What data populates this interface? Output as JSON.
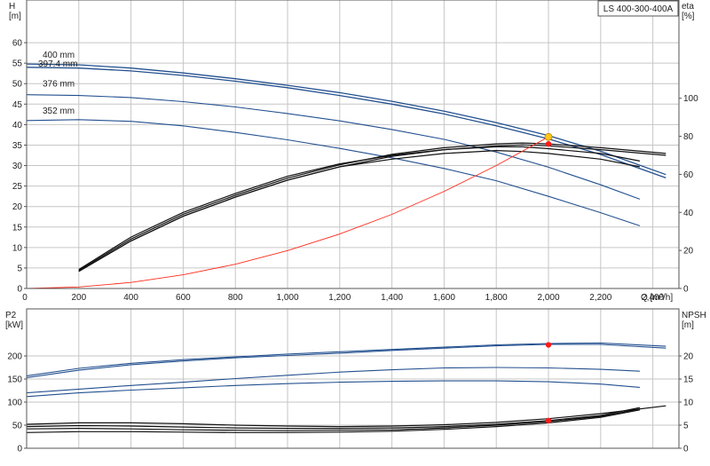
{
  "model_label": "LS 400-300-400A",
  "colors": {
    "head_curve": "#23508f",
    "eff_curve": "#111111",
    "system_curve": "#ff2b1c",
    "duty_point_head": "#ffc61a",
    "duty_point": "#ff1a1a"
  },
  "chart_data": [
    {
      "type": "line",
      "id": "head-efficiency",
      "xlabel": "Q [m³/h]",
      "x_ticks": [
        "0",
        "200",
        "400",
        "600",
        "800",
        "1,000",
        "1,200",
        "1,400",
        "1,600",
        "1,800",
        "2,000",
        "2,200",
        "2,400"
      ],
      "xlim": [
        0,
        2500
      ],
      "ylabel_left": "H [m]",
      "ylabel_left_lines": [
        "H",
        "[m]"
      ],
      "ylim_left": [
        0,
        65
      ],
      "yticks_left": [
        0,
        5,
        10,
        15,
        20,
        25,
        30,
        35,
        40,
        45,
        50,
        55,
        60
      ],
      "ylabel_right": "eta [%]",
      "ylabel_right_lines": [
        "eta",
        "[%]"
      ],
      "ylim_right": [
        0,
        140
      ],
      "yticks_right": [
        0,
        20,
        40,
        60,
        80,
        100
      ],
      "grid": true,
      "head_series": [
        {
          "name": "400 mm",
          "x": [
            0,
            200,
            400,
            600,
            800,
            1000,
            1200,
            1400,
            1600,
            1800,
            2000,
            2200,
            2450
          ],
          "y": [
            54.8,
            54.6,
            53.8,
            52.6,
            51.2,
            49.6,
            47.8,
            45.7,
            43.3,
            40.5,
            37.3,
            33.5,
            27.8
          ]
        },
        {
          "name": "397.4 mm",
          "x": [
            0,
            200,
            400,
            600,
            800,
            1000,
            1200,
            1400,
            1600,
            1800,
            2000,
            2200,
            2450
          ],
          "y": [
            54.0,
            53.8,
            53.1,
            52.0,
            50.6,
            49.0,
            47.1,
            45.0,
            42.6,
            39.7,
            36.5,
            32.7,
            27.0
          ]
        },
        {
          "name": "376 mm",
          "x": [
            0,
            200,
            400,
            600,
            800,
            1000,
            1200,
            1400,
            1600,
            1800,
            2000,
            2200,
            2350
          ],
          "y": [
            47.3,
            47.1,
            46.6,
            45.6,
            44.3,
            42.7,
            40.9,
            38.8,
            36.4,
            33.3,
            29.6,
            25.3,
            21.8
          ]
        },
        {
          "name": "352 mm",
          "x": [
            0,
            200,
            400,
            600,
            800,
            1000,
            1200,
            1400,
            1600,
            1800,
            2000,
            2200,
            2350
          ],
          "y": [
            41.0,
            41.2,
            40.8,
            39.7,
            38.1,
            36.3,
            34.2,
            31.9,
            29.3,
            26.3,
            22.5,
            18.5,
            15.3
          ]
        }
      ],
      "efficiency_series": [
        {
          "x": [
            200,
            400,
            600,
            800,
            1000,
            1200,
            1400,
            1600,
            1800,
            1900,
            2000,
            2200,
            2450
          ],
          "y": [
            9.5,
            26,
            39,
            49,
            58,
            65,
            70.5,
            74,
            76,
            76.5,
            76,
            74,
            71
          ]
        },
        {
          "x": [
            200,
            400,
            600,
            800,
            1000,
            1200,
            1400,
            1600,
            1800,
            1900,
            2000,
            2200,
            2450
          ],
          "y": [
            9,
            25,
            38,
            48,
            57,
            64,
            69.5,
            73,
            75,
            75.5,
            75,
            73,
            70
          ]
        },
        {
          "x": [
            200,
            400,
            600,
            800,
            1000,
            1200,
            1400,
            1600,
            1800,
            1900,
            2000,
            2200,
            2350
          ],
          "y": [
            10,
            27,
            40,
            50,
            59,
            65.5,
            70,
            73,
            74.5,
            74.5,
            73.5,
            71,
            67
          ]
        },
        {
          "x": [
            200,
            400,
            600,
            800,
            1000,
            1200,
            1400,
            1600,
            1800,
            1900,
            2000,
            2200,
            2350
          ],
          "y": [
            9,
            25,
            38,
            48,
            57,
            64,
            68,
            71,
            72.5,
            72,
            71,
            68,
            64
          ]
        }
      ],
      "system_curve": {
        "x": [
          0,
          200,
          400,
          600,
          800,
          1000,
          1200,
          1400,
          1600,
          1800,
          2000
        ],
        "y": [
          0,
          0.37,
          1.48,
          3.33,
          5.92,
          9.25,
          13.3,
          18.1,
          23.7,
          30.0,
          37.0
        ]
      },
      "duty_point_head": {
        "x": 2000,
        "y": 37.0
      },
      "duty_point_eta": {
        "x": 2000,
        "y": 76
      }
    },
    {
      "type": "line",
      "id": "power-npsh",
      "ylabel_left": "P2 [kW]",
      "ylabel_left_lines": [
        "P2",
        "[kW]"
      ],
      "ylim_left": [
        0,
        250
      ],
      "yticks_left": [
        0,
        50,
        100,
        150,
        200
      ],
      "ylabel_right": "NPSH [m]",
      "ylabel_right_lines": [
        "NPSH",
        "[m]"
      ],
      "ylim_right": [
        0,
        25
      ],
      "yticks_right": [
        0,
        5,
        10,
        15,
        20
      ],
      "xlim": [
        0,
        2500
      ],
      "grid": true,
      "power_series": [
        {
          "x": [
            0,
            200,
            400,
            600,
            800,
            1000,
            1200,
            1400,
            1600,
            1800,
            2000,
            2200,
            2450
          ],
          "y": [
            157,
            173,
            184,
            192,
            198,
            204,
            209,
            214,
            219,
            224,
            227,
            228,
            221
          ]
        },
        {
          "x": [
            0,
            200,
            400,
            600,
            800,
            1000,
            1200,
            1400,
            1600,
            1800,
            2000,
            2200,
            2450
          ],
          "y": [
            153,
            169,
            181,
            189,
            196,
            201,
            206,
            212,
            217,
            222,
            225,
            225,
            217
          ]
        },
        {
          "x": [
            0,
            200,
            400,
            600,
            800,
            1000,
            1200,
            1400,
            1600,
            1800,
            2000,
            2200,
            2350
          ],
          "y": [
            120,
            128,
            136,
            143,
            151,
            158,
            165,
            170,
            174,
            175,
            174,
            171,
            167
          ]
        },
        {
          "x": [
            0,
            200,
            400,
            600,
            800,
            1000,
            1200,
            1400,
            1600,
            1800,
            2000,
            2200,
            2350
          ],
          "y": [
            112,
            120,
            126,
            131,
            136,
            140,
            143,
            145,
            146,
            146,
            144,
            139,
            132
          ]
        }
      ],
      "npsh_series": [
        {
          "x": [
            0,
            200,
            400,
            600,
            800,
            1000,
            1200,
            1400,
            1600,
            1800,
            2000,
            2200,
            2450
          ],
          "y": [
            5.2,
            5.5,
            5.5,
            5.3,
            5.0,
            4.8,
            4.7,
            4.8,
            5.1,
            5.6,
            6.4,
            7.5,
            9.2
          ]
        },
        {
          "x": [
            0,
            200,
            400,
            600,
            800,
            1000,
            1200,
            1400,
            1600,
            1800,
            2000,
            2200,
            2350
          ],
          "y": [
            4.7,
            4.9,
            4.8,
            4.6,
            4.4,
            4.3,
            4.3,
            4.4,
            4.7,
            5.2,
            6.0,
            7.1,
            8.8
          ]
        },
        {
          "x": [
            0,
            200,
            400,
            600,
            800,
            1000,
            1200,
            1400,
            1600,
            1800,
            2000,
            2200,
            2350
          ],
          "y": [
            4.2,
            4.3,
            4.2,
            4.0,
            3.9,
            3.8,
            3.9,
            4.0,
            4.4,
            5.0,
            5.8,
            6.9,
            8.5
          ]
        },
        {
          "x": [
            0,
            200,
            400,
            600,
            800,
            1000,
            1200,
            1400,
            1600,
            1800,
            2000,
            2200,
            2350
          ],
          "y": [
            3.4,
            3.6,
            3.6,
            3.5,
            3.4,
            3.4,
            3.5,
            3.7,
            4.1,
            4.7,
            5.5,
            6.7,
            8.3
          ]
        }
      ],
      "duty_point_power": {
        "x": 2000,
        "y": 224
      },
      "duty_point_npsh": {
        "x": 2000,
        "y": 6.0
      }
    }
  ]
}
